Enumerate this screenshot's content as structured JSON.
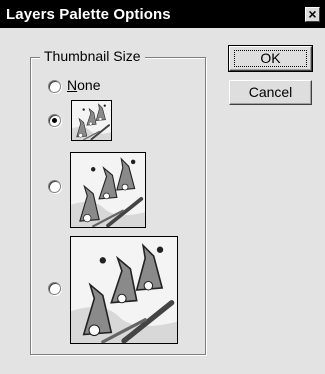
{
  "window": {
    "title": "Layers Palette Options",
    "close_glyph": "×"
  },
  "thumbnail_group": {
    "legend": "Thumbnail Size",
    "options": [
      {
        "label_mnemonic": "N",
        "label_rest": "one",
        "checked": false,
        "size": "none"
      },
      {
        "label": "",
        "checked": true,
        "size": "small"
      },
      {
        "label": "",
        "checked": false,
        "size": "medium"
      },
      {
        "label": "",
        "checked": false,
        "size": "large"
      }
    ]
  },
  "buttons": {
    "ok": "OK",
    "cancel": "Cancel"
  },
  "colors": {
    "dialog_bg": "#e3e3e3",
    "titlebar_bg": "#000000",
    "titlebar_text": "#ffffff",
    "thumbnail_wizard_hat": "#7a7a7a",
    "thumbnail_brush": "#444444"
  },
  "icons": [
    "close-icon",
    "wizard-thumbnail-icon"
  ]
}
